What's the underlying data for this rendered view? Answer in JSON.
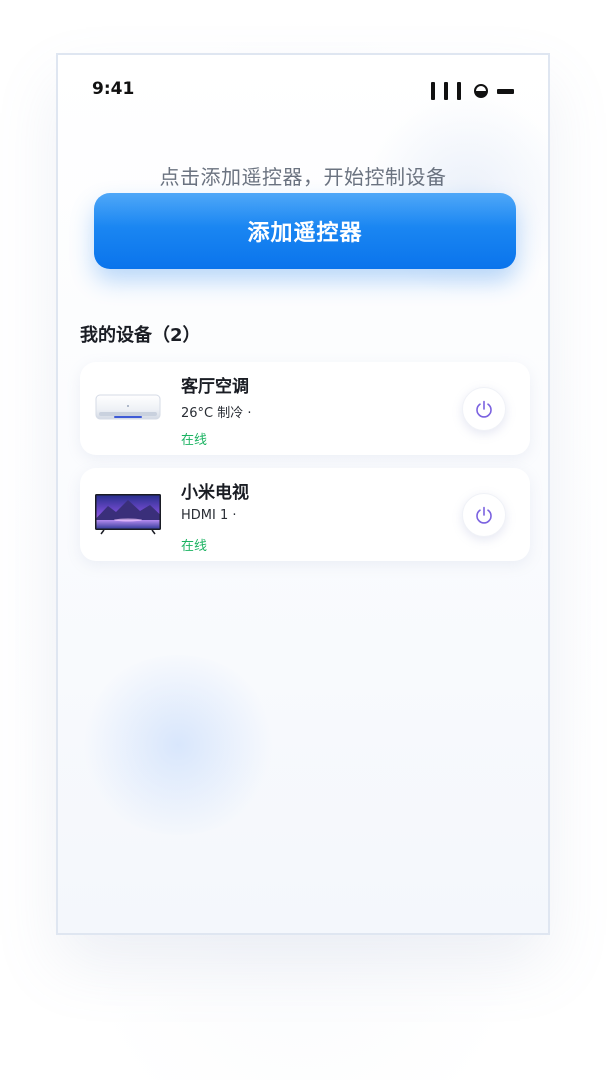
{
  "status_bar": {
    "time": "9:41"
  },
  "hint": "点击添加遥控器，开始控制设备",
  "add_button_label": "添加遥控器",
  "devices_section": {
    "title": "我的设备（2）",
    "items": [
      {
        "name": "客厅空调",
        "state": "26°C 制冷 ·",
        "status": "在线",
        "thumbnail": "air-conditioner-icon"
      },
      {
        "name": "小米电视",
        "state": "HDMI 1 ·",
        "status": "在线",
        "thumbnail": "television-icon"
      }
    ]
  },
  "colors": {
    "primary_blue": "#1a86f2",
    "online_green": "#1cb362",
    "power_icon_purple": "#7b62e0"
  },
  "icons": {
    "power": "power-icon",
    "signal": "signal-icon",
    "wifi": "wifi-icon",
    "battery": "battery-icon"
  }
}
